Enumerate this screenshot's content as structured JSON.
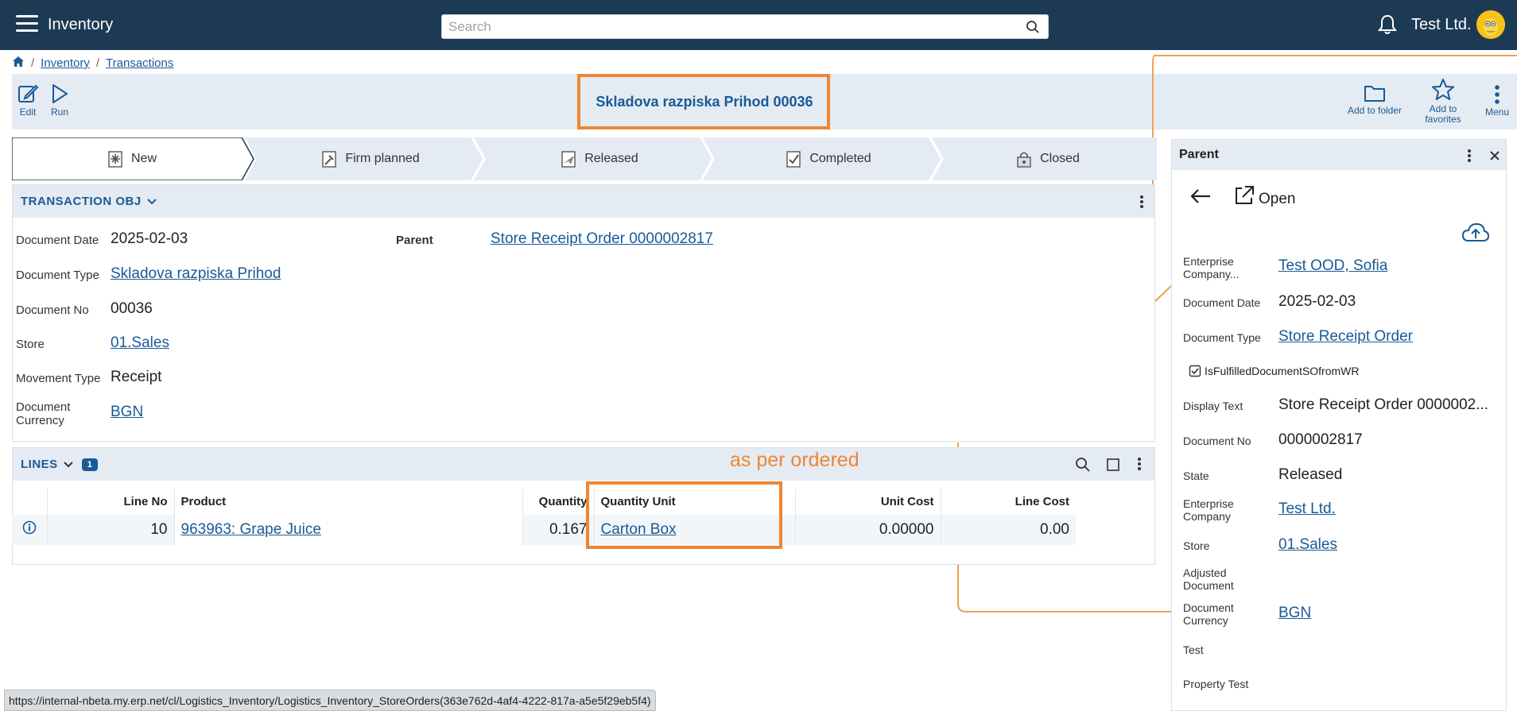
{
  "header": {
    "app_title": "Inventory",
    "search_placeholder": "Search",
    "company": "Test Ltd."
  },
  "breadcrumb": [
    "Inventory",
    "Transactions"
  ],
  "toolbar": {
    "edit": "Edit",
    "run": "Run",
    "title": "Skladova razpiska Prihod 00036",
    "add_to_folder": "Add to folder",
    "add_to_favorites": "Add to favorites",
    "menu": "Menu"
  },
  "stepper": {
    "steps": [
      "New",
      "Firm planned",
      "Released",
      "Completed",
      "Closed"
    ],
    "active": "New"
  },
  "transaction": {
    "section_title": "TRANSACTION OBJ",
    "document_date_label": "Document Date",
    "document_date": "2025-02-03",
    "document_type_label": "Document Type",
    "document_type": "Skladova razpiska Prihod",
    "document_no_label": "Document No",
    "document_no": "00036",
    "store_label": "Store",
    "store": "01.Sales",
    "movement_type_label": "Movement Type",
    "movement_type": "Receipt",
    "currency_label": "Document Currency",
    "currency": "BGN",
    "parent_label": "Parent",
    "parent": "Store Receipt Order 0000002817"
  },
  "lines": {
    "title": "LINES",
    "count": "1",
    "annotation": "as per ordered",
    "columns": [
      "Line No",
      "Product",
      "Quantity",
      "Quantity Unit",
      "Unit Cost",
      "Line Cost"
    ],
    "rows": [
      {
        "line_no": "10",
        "product": "963963: Grape Juice",
        "quantity": "0.167",
        "unit": "Carton Box",
        "unit_cost": "0.00000",
        "line_cost": "0.00"
      }
    ]
  },
  "parent_panel": {
    "title": "Parent",
    "open": "Open",
    "enterprise_company_label": "Enterprise Company...",
    "enterprise_company": "Test OOD, Sofia",
    "document_date_label": "Document Date",
    "document_date": "2025-02-03",
    "document_type_label": "Document Type",
    "document_type": "Store Receipt Order",
    "checkbox_label": "IsFulfilledDocumentSOfromWR",
    "display_text_label": "Display Text",
    "display_text": "Store Receipt Order 0000002...",
    "document_no_label": "Document No",
    "document_no": "0000002817",
    "state_label": "State",
    "state": "Released",
    "ent_company_label": "Enterprise Company",
    "ent_company": "Test Ltd.",
    "store_label": "Store",
    "store": "01.Sales",
    "adjusted_label": "Adjusted Document",
    "currency_label": "Document Currency",
    "currency": "BGN",
    "test_label": "Test",
    "property_test_label": "Property Test"
  },
  "status_url": "https://internal-nbeta.my.erp.net/cl/Logistics_Inventory/Logistics_Inventory_StoreOrders(363e762d-4af4-4222-817a-a5e5f29eb5f4)",
  "colors": {
    "header": "#1d3a55",
    "accent": "#1a5a96",
    "highlight": "#ee8633"
  }
}
